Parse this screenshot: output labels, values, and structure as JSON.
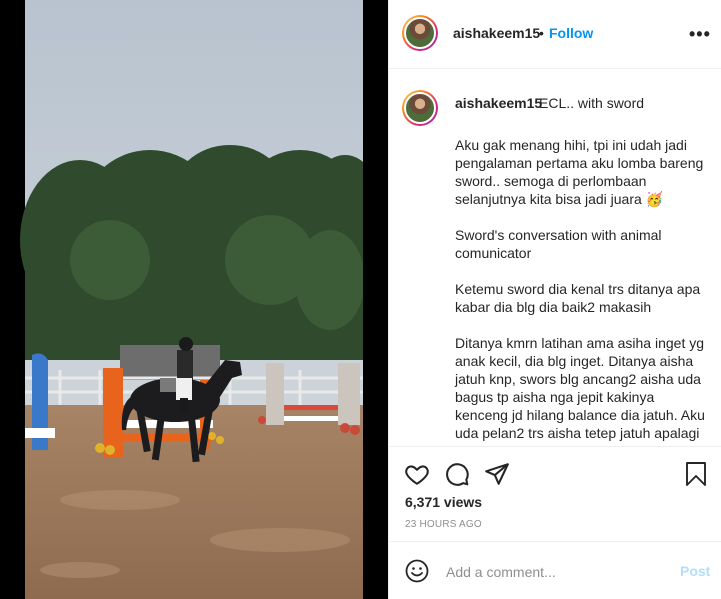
{
  "post": {
    "username": "aishakeem15",
    "dot": "•",
    "follow_label": "Follow",
    "more_label": "•••",
    "caption_first_line": "ECL.. with sword",
    "caption_paragraphs": [
      "Aku gak menang hihi, tpi ini udah jadi pengalaman pertama aku lomba bareng sword.. semoga di perlombaan selanjutnya kita bisa jadi juara 🥳",
      "Sword's conversation with animal comunicator",
      "Ketemu sword dia kenal trs ditanya apa kabar dia blg dia baik2 makasih",
      "Ditanya kmrn latihan ama asiha inget yg anak kecil, dia blg inget. Ditanya aisha jatuh knp, swors blg ancang2 aisha uda bagus tp aisha nga jepit kakinya kenceng jd hilang balance dia jatuh. Aku uda pelan2 trs aisha tetep jatuh apalagi pas dia uda melak lahar"
    ],
    "views": "6,371 views",
    "timestamp": "23 HOURS AGO",
    "comment_placeholder": "Add a comment...",
    "post_label": "Post"
  },
  "icons": {
    "like": "heart-icon",
    "comment": "comment-bubble-icon",
    "share": "paper-plane-icon",
    "save": "bookmark-icon",
    "emoji": "smiley-icon"
  },
  "colors": {
    "accent": "#0095f6",
    "post_disabled": "#b2dffc",
    "muted": "#8e8e8e",
    "text": "#262626"
  }
}
